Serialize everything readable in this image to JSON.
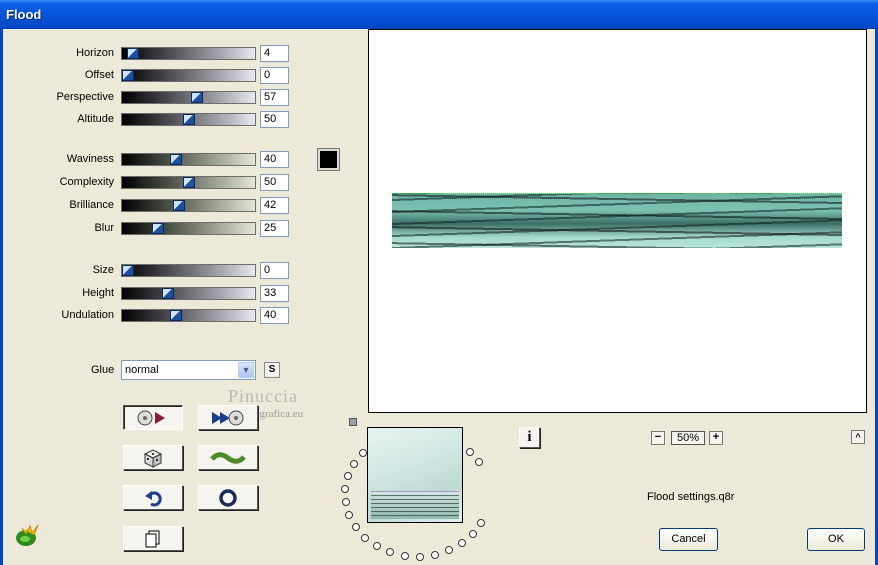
{
  "window": {
    "title": "Flood"
  },
  "sliders": [
    {
      "label": "Horizon",
      "value": "4",
      "fraction": 0.04,
      "tint": "gray"
    },
    {
      "label": "Offset",
      "value": "0",
      "fraction": 0.0,
      "tint": "gray"
    },
    {
      "label": "Perspective",
      "value": "57",
      "fraction": 0.57,
      "tint": "gray"
    },
    {
      "label": "Altitude",
      "value": "50",
      "fraction": 0.5,
      "tint": "gray"
    },
    {
      "label": "Waviness",
      "value": "40",
      "fraction": 0.4,
      "tint": "green"
    },
    {
      "label": "Complexity",
      "value": "50",
      "fraction": 0.5,
      "tint": "green"
    },
    {
      "label": "Brilliance",
      "value": "42",
      "fraction": 0.42,
      "tint": "green"
    },
    {
      "label": "Blur",
      "value": "25",
      "fraction": 0.25,
      "tint": "green"
    },
    {
      "label": "Size",
      "value": "0",
      "fraction": 0.0,
      "tint": "gray"
    },
    {
      "label": "Height",
      "value": "33",
      "fraction": 0.33,
      "tint": "gray"
    },
    {
      "label": "Undulation",
      "value": "40",
      "fraction": 0.4,
      "tint": "gray"
    }
  ],
  "color_swatch": "#000000",
  "glue": {
    "label": "Glue",
    "value": "normal",
    "s_label": "S"
  },
  "watermark": {
    "line1": "Pinuccia",
    "line2": "www.marditegrafica.eu"
  },
  "preview": {
    "water_color": "#7cc2b2"
  },
  "zoom": {
    "value": "50%",
    "minus": "−",
    "plus": "+",
    "collapse": "^"
  },
  "info_label": "i",
  "settings_file": "Flood settings.q8r",
  "buttons": {
    "cancel": "Cancel",
    "ok": "OK"
  }
}
